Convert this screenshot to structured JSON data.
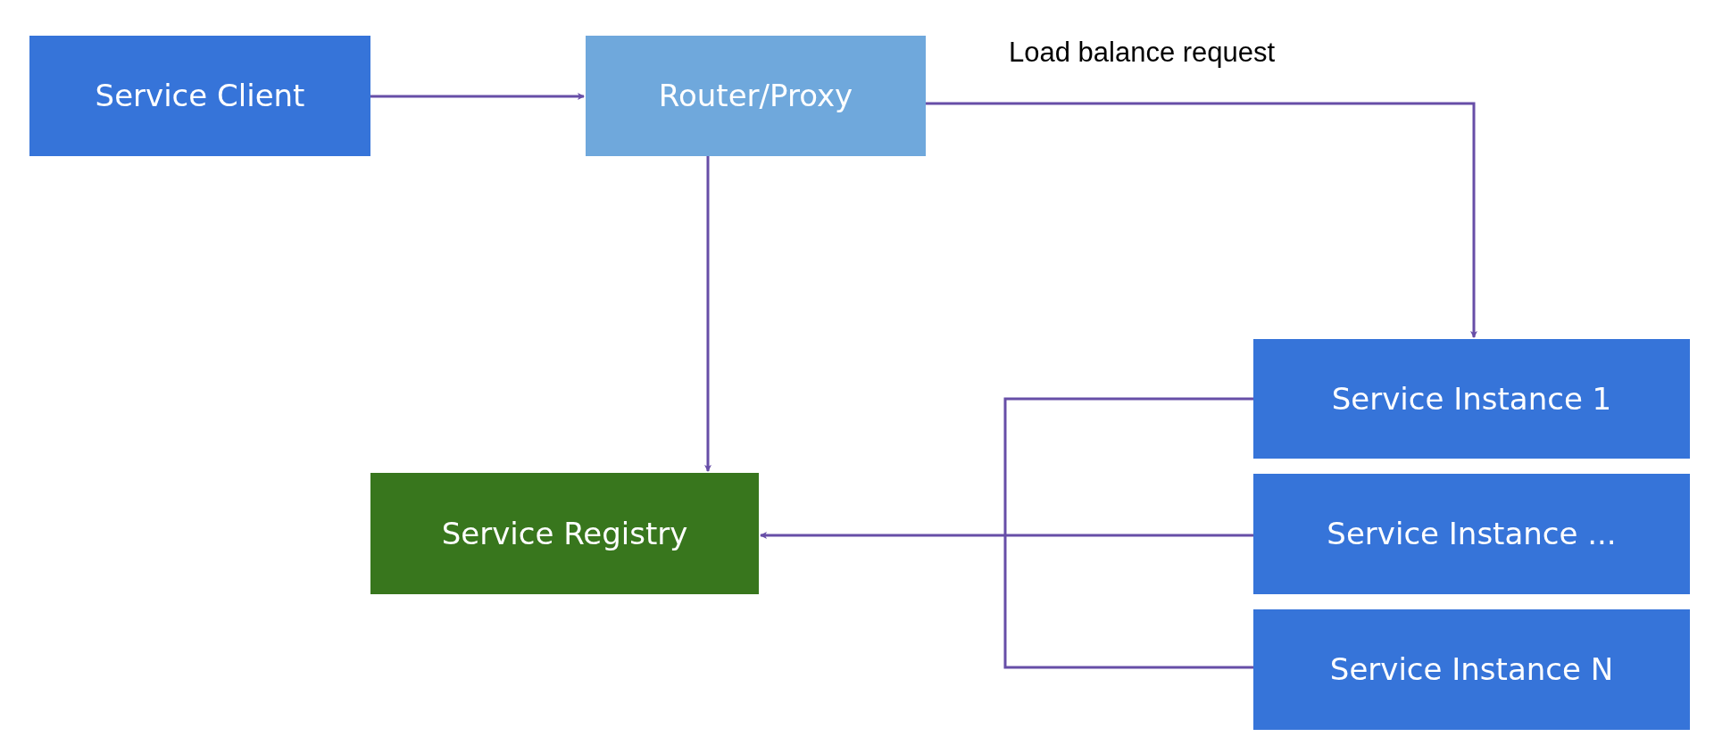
{
  "nodes": [
    {
      "label": "Service Client",
      "color": "#3674d9"
    },
    {
      "label": "Router/Proxy",
      "color": "#6fa8dc"
    },
    {
      "label": "Service Registry",
      "color": "#38761d"
    },
    {
      "label": "Service Instance 1",
      "color": "#3674d9"
    },
    {
      "label": "Service Instance ...",
      "color": "#3674d9"
    },
    {
      "label": "Service Instance N",
      "color": "#3674d9"
    }
  ],
  "connector_label": "Load balance request"
}
